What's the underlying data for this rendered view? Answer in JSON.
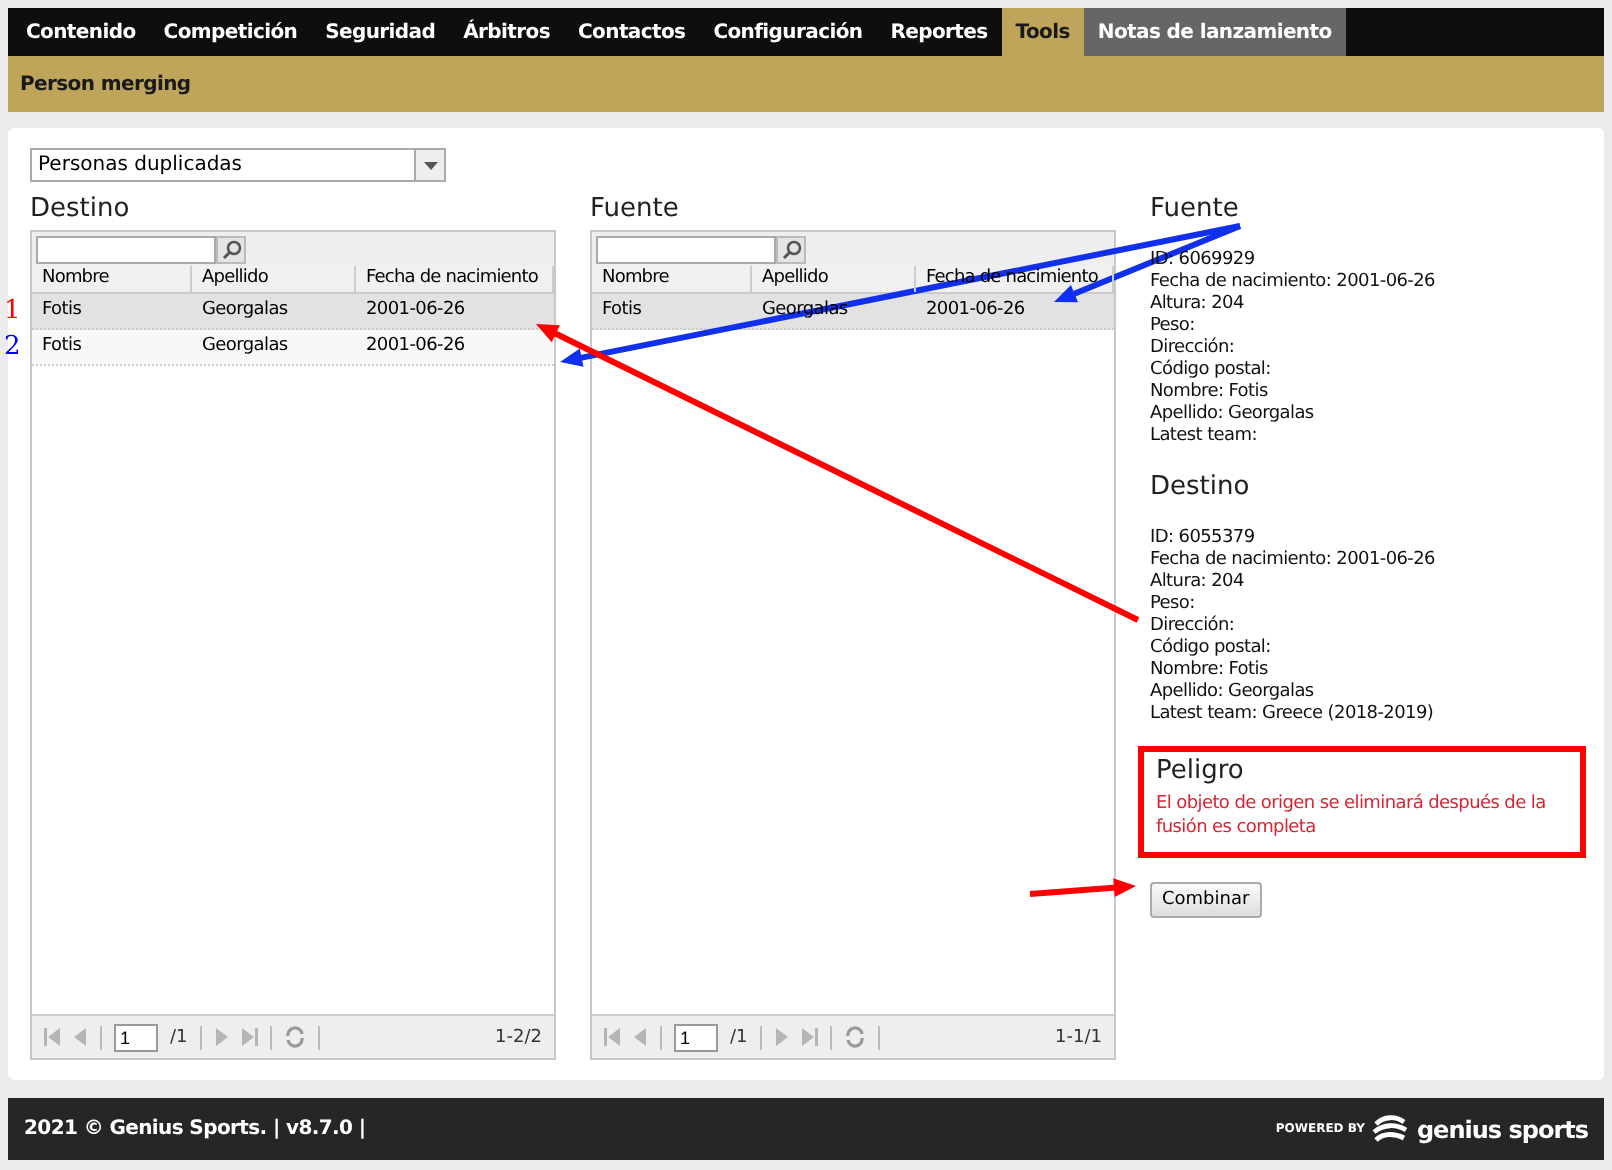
{
  "nav": [
    {
      "label": "Contenido",
      "selected": false,
      "hovered": false
    },
    {
      "label": "Competición",
      "selected": false,
      "hovered": false
    },
    {
      "label": "Seguridad",
      "selected": false,
      "hovered": false
    },
    {
      "label": "Árbitros",
      "selected": false,
      "hovered": false
    },
    {
      "label": "Contactos",
      "selected": false,
      "hovered": false
    },
    {
      "label": "Configuración",
      "selected": false,
      "hovered": false
    },
    {
      "label": "Reportes",
      "selected": false,
      "hovered": false
    },
    {
      "label": "Tools",
      "selected": true,
      "hovered": false
    },
    {
      "label": "Notas de lanzamiento",
      "selected": false,
      "hovered": true
    }
  ],
  "subtitle": "Person merging",
  "dropdown": {
    "value": "Personas duplicadas"
  },
  "grids": [
    {
      "title": "Destino",
      "columns": [
        "Nombre",
        "Apellido",
        "Fecha de nacimiento"
      ],
      "rows": [
        {
          "cells": [
            "Fotis",
            "Georgalas",
            "2001-06-26"
          ],
          "selected": true
        },
        {
          "cells": [
            "Fotis",
            "Georgalas",
            "2001-06-26"
          ],
          "selected": false
        }
      ],
      "pager": {
        "page": "1",
        "total": "/1",
        "range": "1-2/2"
      }
    },
    {
      "title": "Fuente",
      "columns": [
        "Nombre",
        "Apellido",
        "Fecha de nacimiento"
      ],
      "rows": [
        {
          "cells": [
            "Fotis",
            "Georgalas",
            "2001-06-26"
          ],
          "selected": true
        }
      ],
      "pager": {
        "page": "1",
        "total": "/1",
        "range": "1-1/1"
      }
    }
  ],
  "details": [
    {
      "title": "Fuente",
      "lines": [
        "ID: 6069929",
        "Fecha de nacimiento: 2001-06-26",
        "Altura: 204",
        "Peso:",
        "Dirección:",
        "Código postal:",
        "Nombre: Fotis",
        "Apellido: Georgalas",
        "Latest team:"
      ]
    },
    {
      "title": "Destino",
      "lines": [
        "ID: 6055379",
        "Fecha de nacimiento: 2001-06-26",
        "Altura: 204",
        "Peso:",
        "Dirección:",
        "Código postal:",
        "Nombre: Fotis",
        "Apellido: Georgalas",
        "Latest team: Greece (2018-2019)"
      ]
    }
  ],
  "warning": {
    "title": "Peligro",
    "message": "El objeto de origen se eliminará después de la fusión es completa"
  },
  "merge_button": "Combinar",
  "annotations": [
    {
      "label": "1",
      "color": "#ff0000"
    },
    {
      "label": "2",
      "color": "#0000ff"
    }
  ],
  "footer": {
    "text": "2021 © Genius Sports. | v8.7.0 |",
    "powered_by": "POWERED BY",
    "brand": "genius sports"
  }
}
